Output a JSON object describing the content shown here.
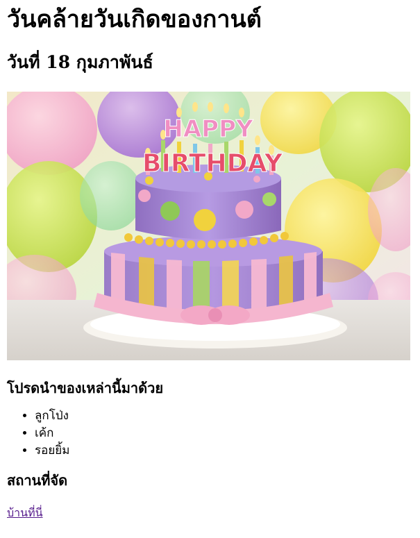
{
  "page": {
    "title": "วันคล้ายวันเกิดของกานต์",
    "date": "วันที่ 18 กุมภาพันธ์",
    "image_text": "HAPPY BIRTHDAY",
    "bring_heading": "โปรดนำของเหล่านี้มาด้วย",
    "bring_items": [
      "ลูกโป่ง",
      "เค้ก",
      "รอยยิ้ม"
    ],
    "venue_heading": "สถานที่จัด",
    "venue_link": "บ้านที่นี่"
  },
  "colors": {
    "link": "#551a8b"
  }
}
